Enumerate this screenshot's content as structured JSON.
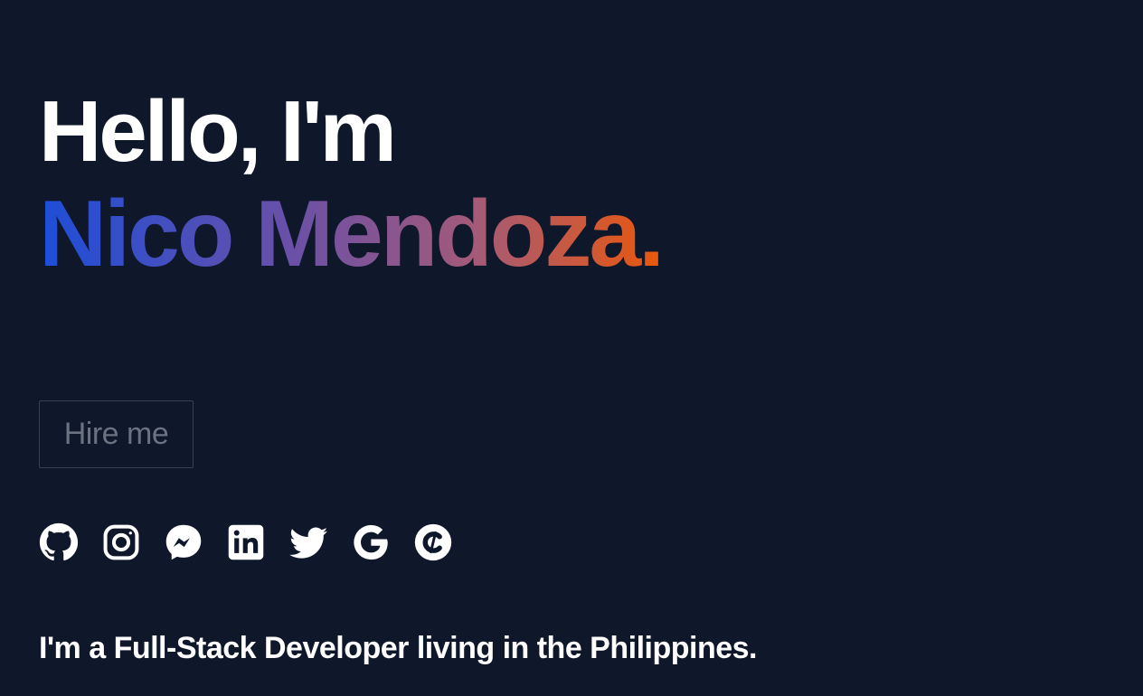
{
  "hero": {
    "greeting": "Hello, I'm",
    "name": "Nico Mendoza.",
    "name_gradient": [
      "#1d4ed8",
      "#6950a8",
      "#a45a78",
      "#ea580c"
    ]
  },
  "cta": {
    "hire_label": "Hire me"
  },
  "socials": [
    {
      "icon": "github-icon"
    },
    {
      "icon": "instagram-icon"
    },
    {
      "icon": "messenger-icon"
    },
    {
      "icon": "linkedin-icon"
    },
    {
      "icon": "twitter-icon"
    },
    {
      "icon": "google-icon"
    },
    {
      "icon": "codementor-icon"
    }
  ],
  "tagline": "I'm a Full-Stack Developer living in the Philippines.",
  "colors": {
    "background": "#0f172a",
    "text": "#ffffff",
    "button_border": "#374151",
    "button_text": "#6b7280"
  }
}
